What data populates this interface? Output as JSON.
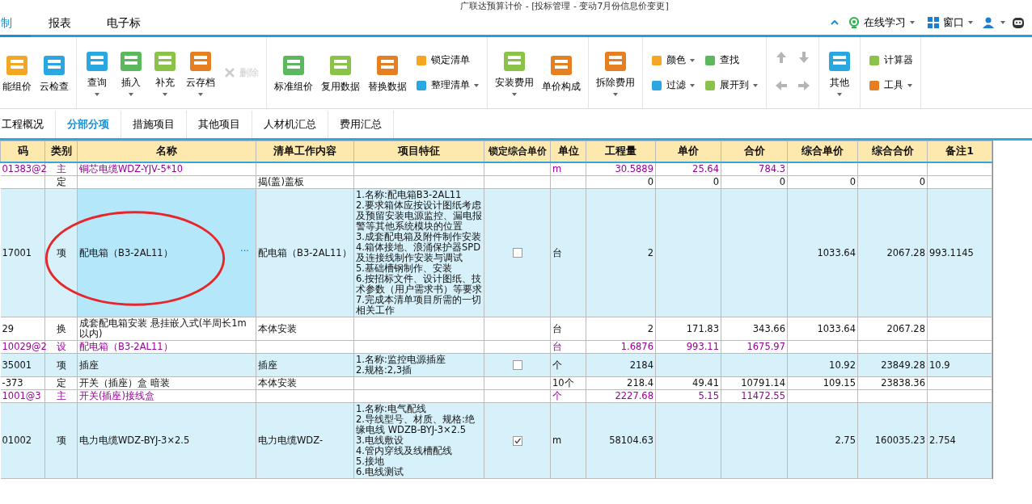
{
  "window": {
    "title": "广联达预算计价 - [投标管理 - 变动7月份信息价变更]"
  },
  "ribbon_tabs": [
    {
      "label": "制",
      "selected": true
    },
    {
      "label": "报表",
      "selected": false
    },
    {
      "label": "电子标",
      "selected": false
    }
  ],
  "top_right": {
    "links": [
      {
        "label": "在线学习"
      },
      {
        "label": "窗口"
      }
    ]
  },
  "toolbar": {
    "groups": [
      {
        "items": [
          {
            "label": "能组价",
            "kind": "large",
            "dropdown": false,
            "disabled": false
          },
          {
            "label": "云检查",
            "kind": "large",
            "dropdown": false,
            "disabled": false
          }
        ]
      },
      {
        "items": [
          {
            "label": "查询",
            "kind": "large",
            "dropdown": true,
            "disabled": false
          },
          {
            "label": "插入",
            "kind": "large",
            "dropdown": true,
            "disabled": false
          },
          {
            "label": "补充",
            "kind": "large",
            "dropdown": true,
            "disabled": false
          },
          {
            "label": "云存档",
            "kind": "large",
            "dropdown": true,
            "disabled": false
          },
          {
            "label": "删除",
            "kind": "small",
            "dropdown": false,
            "disabled": true
          }
        ]
      },
      {
        "items": [
          {
            "label": "标准组价",
            "kind": "large",
            "dropdown": false,
            "disabled": false
          },
          {
            "label": "复用数据",
            "kind": "large",
            "dropdown": false,
            "disabled": false
          },
          {
            "label": "替换数据",
            "kind": "large",
            "dropdown": false,
            "disabled": false
          },
          {
            "label": "锁定清单",
            "kind": "small",
            "dropdown": false,
            "disabled": false
          },
          {
            "label": "整理清单",
            "kind": "small",
            "dropdown": true,
            "disabled": false
          }
        ]
      },
      {
        "items": [
          {
            "label": "安装费用",
            "kind": "large",
            "dropdown": true,
            "disabled": false
          },
          {
            "label": "单价构成",
            "kind": "large",
            "dropdown": false,
            "disabled": false
          }
        ]
      },
      {
        "items": [
          {
            "label": "拆除费用",
            "kind": "large",
            "dropdown": true,
            "disabled": false
          }
        ]
      },
      {
        "items": [
          {
            "label": "颜色",
            "kind": "small",
            "dropdown": true,
            "disabled": false
          },
          {
            "label": "过滤",
            "kind": "small",
            "dropdown": true,
            "disabled": false
          },
          {
            "label": "查找",
            "kind": "small",
            "dropdown": false,
            "disabled": false
          },
          {
            "label": "展开到",
            "kind": "small",
            "dropdown": true,
            "disabled": false
          }
        ]
      },
      {
        "items": [
          {
            "kind": "arrow",
            "disabled": true
          },
          {
            "kind": "arrow",
            "disabled": true
          },
          {
            "kind": "arrow",
            "disabled": true
          },
          {
            "kind": "arrow",
            "disabled": true
          }
        ]
      },
      {
        "items": [
          {
            "label": "其他",
            "kind": "large",
            "dropdown": true,
            "disabled": false
          }
        ]
      },
      {
        "items": [
          {
            "label": "计算器",
            "kind": "small",
            "dropdown": false,
            "disabled": false
          },
          {
            "label": "工具",
            "kind": "small",
            "dropdown": true,
            "disabled": false
          }
        ]
      }
    ]
  },
  "sub_tabs": [
    {
      "label": "工程概况",
      "selected": false
    },
    {
      "label": "分部分项",
      "selected": true
    },
    {
      "label": "措施项目",
      "selected": false
    },
    {
      "label": "其他项目",
      "selected": false
    },
    {
      "label": "人材机汇总",
      "selected": false
    },
    {
      "label": "费用汇总",
      "selected": false
    }
  ],
  "table": {
    "columns": [
      "码",
      "类别",
      "名称",
      "清单工作内容",
      "项目特征",
      "锁定综合单价",
      "单位",
      "工程量",
      "单价",
      "合价",
      "综合单价",
      "综合合价",
      "备注1"
    ],
    "rows": [
      {
        "kind": "main",
        "selected": false,
        "code": "01383@2",
        "type": "主",
        "name": "铜芯电缆WDZ-YJV-5*10",
        "unit": "m",
        "qty": "30.5889",
        "price": "25.64",
        "total": "784.3"
      },
      {
        "kind": "quota",
        "selected": false,
        "type": "定",
        "content": "揭(盖)盖板",
        "qty": "0",
        "price": "0",
        "total": "0",
        "comp_price": "0",
        "comp_total": "0"
      },
      {
        "kind": "item",
        "selected": true,
        "code": "17001",
        "type": "项",
        "name": "配电箱（B3-2AL11）",
        "action": "···",
        "content": "配电箱（B3-2AL11）",
        "features": [
          "1.名称:配电箱B3-2AL11",
          "2.要求箱体应按设计图纸考虑及预留安装电源监控、漏电报警等其他系统模块的位置",
          "3.成套配电箱及附件制作安装",
          "4.箱体接地、浪涌保护器SPD及连接线制作安装与调试",
          "5.基础槽钢制作、安装",
          "6.按招标文件、设计图纸、技术参数（用户需求书）等要求",
          "7.完成本清单项目所需的一切相关工作"
        ],
        "locked": false,
        "unit": "台",
        "qty": "2",
        "comp_price": "1033.64",
        "comp_total": "2067.28",
        "note": "993.1145"
      },
      {
        "kind": "quota",
        "selected": false,
        "code": "29",
        "type": "换",
        "name": "成套配电箱安装 悬挂嵌入式(半周长1m以内)",
        "content": "本体安装",
        "unit": "台",
        "qty": "2",
        "price": "171.83",
        "total": "343.66",
        "comp_price": "1033.64",
        "comp_total": "2067.28"
      },
      {
        "kind": "main",
        "selected": false,
        "code": "10029@2",
        "type": "设",
        "name": "配电箱（B3-2AL11）",
        "unit": "台",
        "qty": "1.6876",
        "price": "993.11",
        "total": "1675.97"
      },
      {
        "kind": "item",
        "selected": false,
        "code": "35001",
        "type": "项",
        "name": "插座",
        "content": "插座",
        "features": [
          "1.名称:监控电源插座",
          "2.规格:2,3插"
        ],
        "locked": false,
        "unit": "个",
        "qty": "2184",
        "comp_price": "10.92",
        "comp_total": "23849.28",
        "note": "10.9"
      },
      {
        "kind": "quota",
        "selected": false,
        "code": "-373",
        "type": "定",
        "name": "开关（插座）盒 暗装",
        "content": "本体安装",
        "unit": "10个",
        "qty": "218.4",
        "price": "49.41",
        "total": "10791.14",
        "comp_price": "109.15",
        "comp_total": "23838.36"
      },
      {
        "kind": "main",
        "selected": false,
        "code": "1001@3",
        "type": "主",
        "name": "开关(插座)接线盒",
        "unit": "个",
        "qty": "2227.68",
        "price": "5.15",
        "total": "11472.55"
      },
      {
        "kind": "item",
        "selected": false,
        "code": "01002",
        "type": "项",
        "name": "电力电缆WDZ-BYJ-3×2.5",
        "content": "电力电缆WDZ-",
        "features": [
          "1.名称:电气配线",
          "2.导线型号、材质、规格:绝缘电线 WDZB-BYJ-3×2.5",
          "3.电线敷设",
          "4.管内穿线及线槽配线",
          "5.接地",
          "6.电线测试"
        ],
        "locked": true,
        "unit": "m",
        "qty": "58104.63",
        "comp_price": "2.75",
        "comp_total": "160035.23",
        "note": "2.754"
      }
    ]
  }
}
